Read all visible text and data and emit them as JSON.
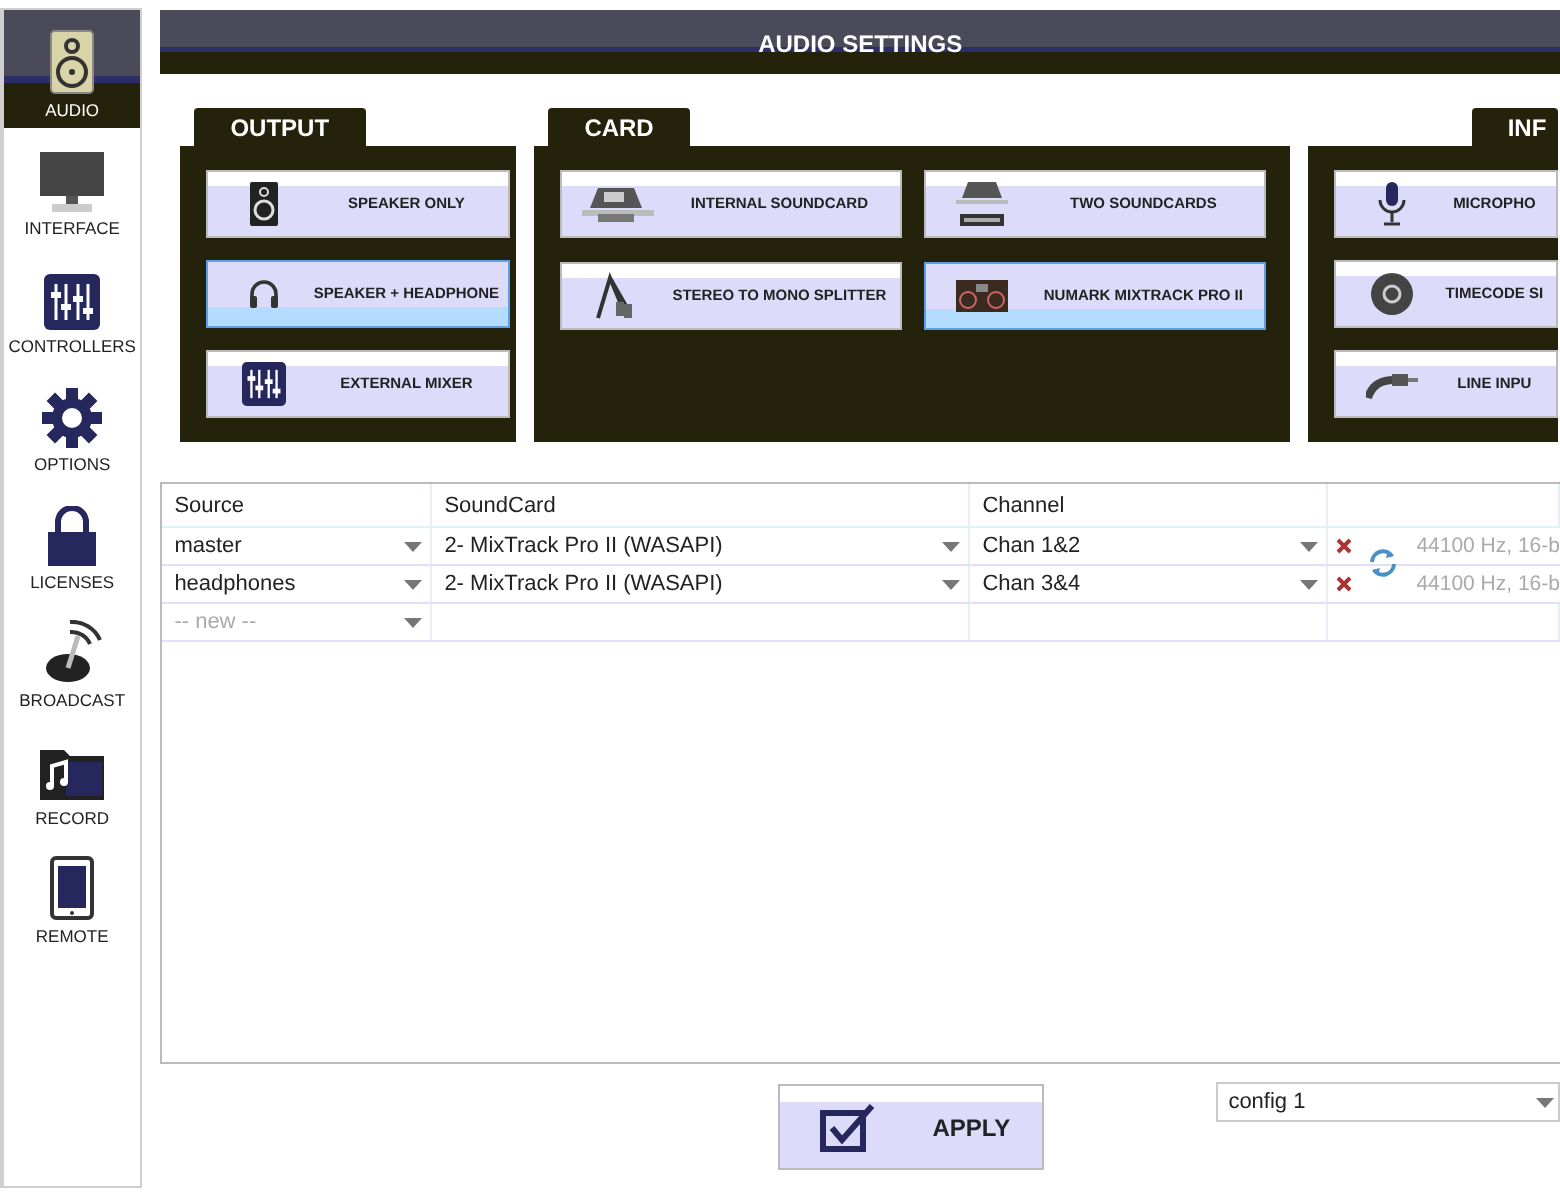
{
  "sidebar": {
    "items": [
      {
        "label": "AUDIO",
        "selected": true
      },
      {
        "label": "INTERFACE",
        "selected": false
      },
      {
        "label": "CONTROLLERS",
        "selected": false
      },
      {
        "label": "OPTIONS",
        "selected": false
      },
      {
        "label": "LICENSES",
        "selected": false
      },
      {
        "label": "BROADCAST",
        "selected": false
      },
      {
        "label": "RECORD",
        "selected": false
      },
      {
        "label": "REMOTE",
        "selected": false
      }
    ]
  },
  "header": {
    "title": "AUDIO SETTINGS"
  },
  "panels": [
    {
      "title": "OUTPUT",
      "buttons": [
        {
          "label": "SPEAKER ONLY",
          "selected": false
        },
        {
          "label": "SPEAKER + HEADPHONE",
          "selected": true
        },
        {
          "label": "EXTERNAL MIXER",
          "selected": false
        }
      ]
    },
    {
      "title": "CARD",
      "buttons": [
        {
          "label": "INTERNAL SOUNDCARD",
          "selected": false
        },
        {
          "label": "TWO SOUNDCARDS",
          "selected": false
        },
        {
          "label": "STEREO TO MONO SPLITTER",
          "selected": false
        },
        {
          "label": "NUMARK MIXTRACK PRO II",
          "selected": true
        }
      ]
    },
    {
      "title": "INF",
      "buttons": [
        {
          "label": "MICROPHO",
          "selected": false
        },
        {
          "label": "TIMECODE SI",
          "selected": false
        },
        {
          "label": "LINE INPU",
          "selected": false
        }
      ]
    }
  ],
  "table": {
    "columns": [
      "Source",
      "SoundCard",
      "Channel"
    ],
    "rows": [
      {
        "source": "master",
        "soundcard": "2- MixTrack Pro II (WASAPI)",
        "channel": "Chan 1&2",
        "format": "44100 Hz, 16-b"
      },
      {
        "source": "headphones",
        "soundcard": "2- MixTrack Pro II (WASAPI)",
        "channel": "Chan 3&4",
        "format": "44100 Hz, 16-b"
      }
    ],
    "new_row": {
      "placeholder": "-- new --"
    }
  },
  "apply_button": {
    "label": "APPLY"
  },
  "config_select": {
    "value": "config 1"
  }
}
